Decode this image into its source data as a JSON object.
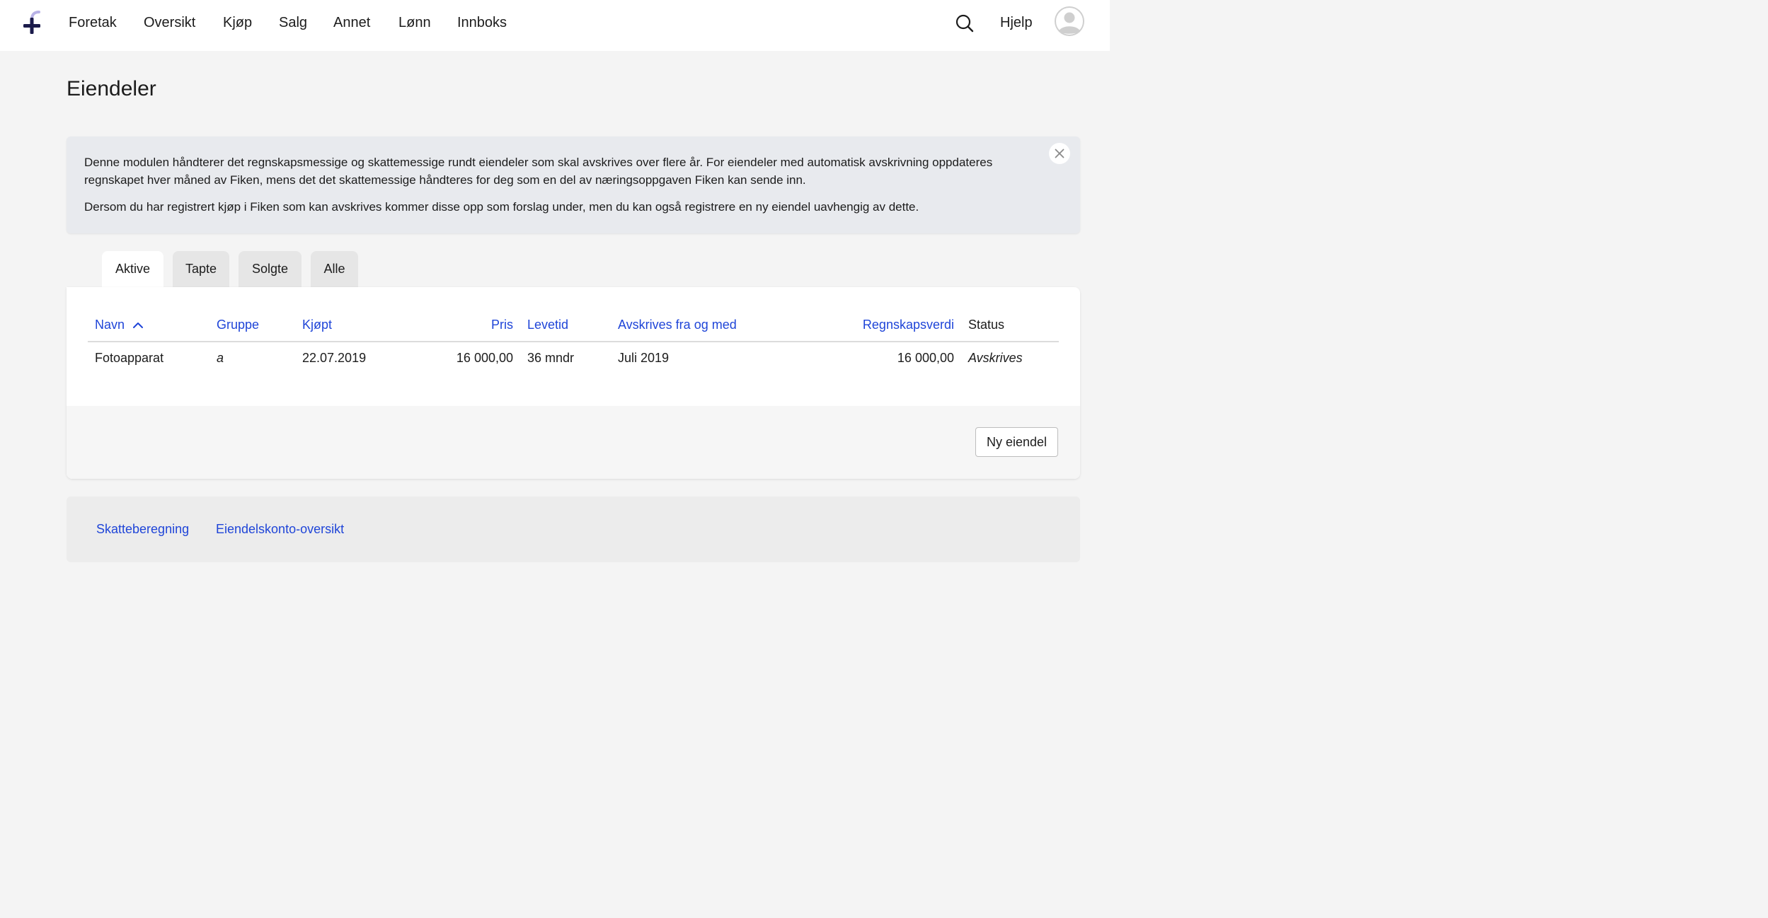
{
  "nav": {
    "items": [
      "Foretak",
      "Oversikt",
      "Kjøp",
      "Salg",
      "Annet",
      "Lønn",
      "Innboks"
    ],
    "help": "Hjelp"
  },
  "page": {
    "title": "Eiendeler"
  },
  "info": {
    "paragraph1": "Denne modulen håndterer det regnskapsmessige og skattemessige rundt eiendeler som skal avskrives over flere år. For eiendeler med automatisk avskrivning oppdateres regnskapet hver måned av Fiken, mens det det skattemessige håndteres for deg som en del av næringsoppgaven Fiken kan sende inn.",
    "paragraph2": "Dersom du har registrert kjøp i Fiken som kan avskrives kommer disse opp som forslag under, men du kan også registrere en ny eiendel uavhengig av dette."
  },
  "tabs": [
    {
      "label": "Aktive",
      "active": true
    },
    {
      "label": "Tapte",
      "active": false
    },
    {
      "label": "Solgte",
      "active": false
    },
    {
      "label": "Alle",
      "active": false
    }
  ],
  "table": {
    "columns": {
      "navn": "Navn",
      "gruppe": "Gruppe",
      "kjopt": "Kjøpt",
      "pris": "Pris",
      "levetid": "Levetid",
      "avskrives_fra": "Avskrives fra og med",
      "regnskapsverdi": "Regnskapsverdi",
      "status": "Status"
    },
    "sort": {
      "column": "navn",
      "direction": "ascending"
    },
    "rows": [
      {
        "navn": "Fotoapparat",
        "gruppe": "a",
        "kjopt": "22.07.2019",
        "pris": "16 000,00",
        "levetid": "36 mndr",
        "avskrives_fra": "Juli 2019",
        "regnskapsverdi": "16 000,00",
        "status": "Avskrives"
      }
    ]
  },
  "actions": {
    "new_asset": "Ny eiendel"
  },
  "footer_links": {
    "tax": "Skatteberegning",
    "accounts": "Eiendelskonto-oversikt"
  },
  "colors": {
    "link": "#1f45d8",
    "logo": "#1b1b4b",
    "logo_accent": "#b8b2e6"
  }
}
